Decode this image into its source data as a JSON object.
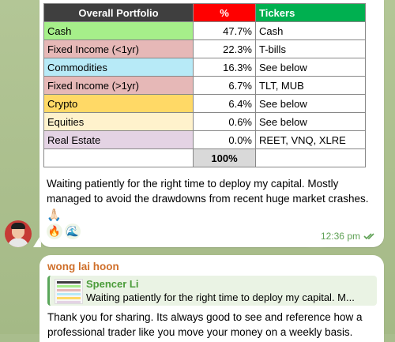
{
  "portfolio_table": {
    "headers": [
      "Overall Portfolio",
      "%",
      "Tickers"
    ],
    "rows": [
      {
        "name": "Cash",
        "pct": "47.7%",
        "tickers": "Cash",
        "color": "#a6ef8a"
      },
      {
        "name": "Fixed Income (<1yr)",
        "pct": "22.3%",
        "tickers": "T-bills",
        "color": "#e6b8b7"
      },
      {
        "name": "Commodities",
        "pct": "16.3%",
        "tickers": "See below",
        "color": "#b7eaf7"
      },
      {
        "name": "Fixed Income (>1yr)",
        "pct": "6.7%",
        "tickers": "TLT, MUB",
        "color": "#e6b8b7"
      },
      {
        "name": "Crypto",
        "pct": "6.4%",
        "tickers": "See below",
        "color": "#ffd966"
      },
      {
        "name": "Equities",
        "pct": "0.6%",
        "tickers": "See below",
        "color": "#fff2cc"
      },
      {
        "name": "Real Estate",
        "pct": "0.0%",
        "tickers": "REET, VNQ, XLRE",
        "color": "#e4d3e4"
      }
    ],
    "total": "100%"
  },
  "message1": {
    "text": "Waiting patiently for the right time to deploy my capital. Mostly managed to avoid the drawdowns from recent huge market crashes.",
    "emoji": "🙏🏻",
    "reactions": [
      "🔥",
      "🌊"
    ],
    "time": "12:36 pm",
    "read_icon": "double-check-icon"
  },
  "message2": {
    "sender": "wong lai hoon",
    "reply": {
      "name": "Spencer Li",
      "text": "Waiting patiently for the right time to deploy my capital. M..."
    },
    "text": "Thank you for sharing. Its always good to see and reference how a professional trader like you move your money on a weekly basis."
  },
  "colors": {
    "chat_background": "#a9bd8d",
    "sender_name": "#cf6f2a",
    "reply_name": "#4b9c3a",
    "timestamp": "#5fa155"
  }
}
